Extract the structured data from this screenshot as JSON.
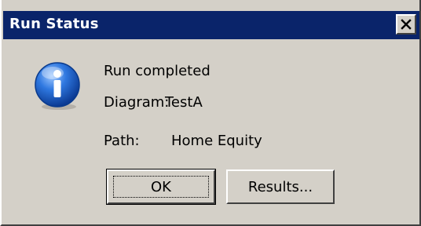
{
  "window": {
    "title": "Run Status",
    "close_icon": "close-icon"
  },
  "message": {
    "icon": "info-icon",
    "status": "Run completed",
    "diagram_label": "Diagram:",
    "diagram_value": "TestA",
    "path_label": "Path:",
    "path_value": "Home Equity"
  },
  "buttons": {
    "ok_label": "OK",
    "results_label": "Results..."
  },
  "colors": {
    "titlebar": "#0a246a",
    "face": "#d4d0c8",
    "icon_blue": "#1d62c8"
  }
}
